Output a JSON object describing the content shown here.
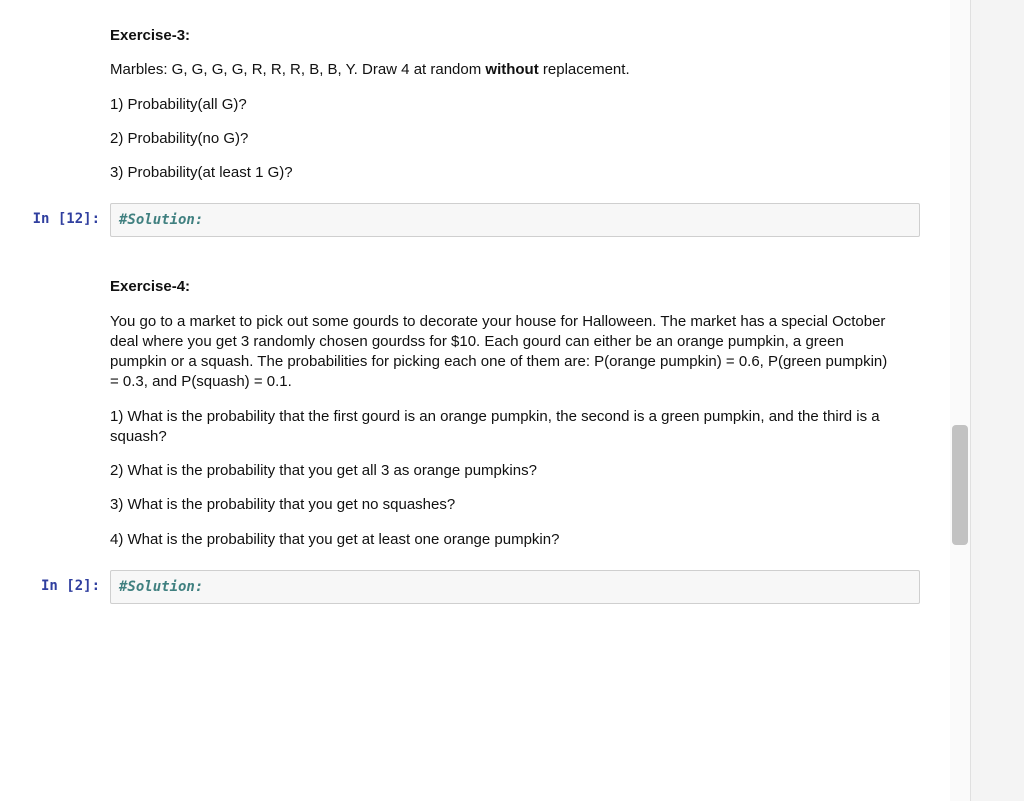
{
  "cells": {
    "ex3": {
      "title": "Exercise-3:",
      "premise_pre": "Marbles: G, G, G, G, R, R, R, B, B, Y. Draw 4 at random ",
      "premise_bold": "without",
      "premise_post": " replacement.",
      "q1": "1) Probability(all G)?",
      "q2": "2) Probability(no G)?",
      "q3": "3) Probability(at least 1 G)?"
    },
    "code1": {
      "prompt_in": "In [",
      "prompt_num": "12",
      "prompt_close": "]:",
      "content": "#Solution:"
    },
    "ex4": {
      "title": "Exercise-4:",
      "premise": "You go to a market to pick out some gourds to decorate your house for Halloween. The market has a special October deal where you get 3 randomly chosen gourdss for $10. Each gourd can either be an orange pumpkin, a green pumpkin or a squash. The probabilities for picking each one of them are: P(orange pumpkin) = 0.6, P(green pumpkin) = 0.3, and P(squash) = 0.1.",
      "q1": "1) What is the probability that the first gourd is an orange pumpkin, the second is a green pumpkin, and the third is a squash?",
      "q2": "2) What is the probability that you get all 3 as orange pumpkins?",
      "q3": "3) What is the probability that you get no squashes?",
      "q4": "4) What is the probability that you get at least one orange pumpkin?"
    },
    "code2": {
      "prompt_in": "In [",
      "prompt_num": "2",
      "prompt_close": "]:",
      "content": "#Solution:"
    }
  }
}
